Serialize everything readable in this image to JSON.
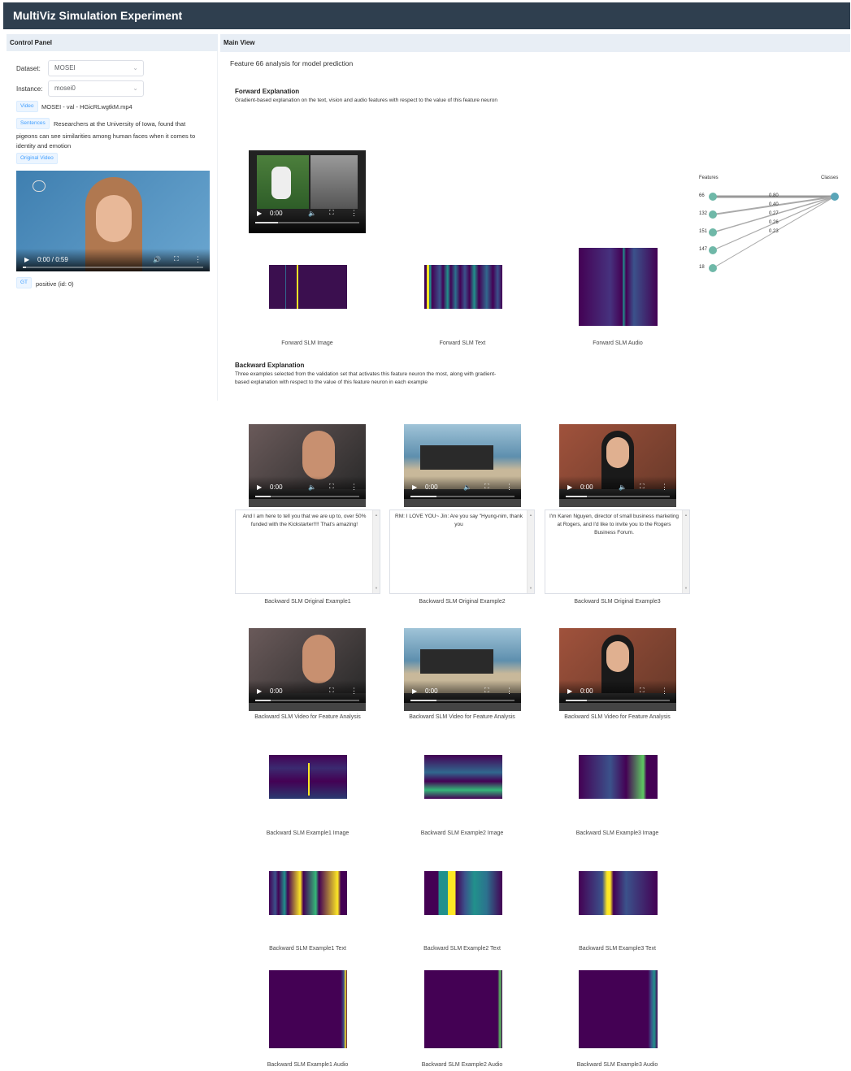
{
  "app": {
    "title": "MultiViz Simulation Experiment"
  },
  "control_panel": {
    "title": "Control Panel",
    "dataset_label": "Dataset:",
    "dataset_value": "MOSEI",
    "instance_label": "Instance:",
    "instance_value": "mosei0",
    "video_tag": "Video",
    "video_text": "MOSEI - val - HGicRLwgtkM.mp4",
    "sentences_tag": "Sentences",
    "sentences_text_line1": "Researchers at the University of Iowa, found that",
    "sentences_text_line2": "pigeons can see similarities among human faces when it comes to",
    "sentences_text_line3": "identity and emotion",
    "original_video_tag": "Original Video",
    "player_time": "0:00 / 0:59",
    "gt_tag": "GT",
    "gt_text": "positive (id: 0)"
  },
  "main_view": {
    "title": "Main View",
    "subtitle": "Feature 66 analysis for model prediction",
    "forward": {
      "title": "Forward Explanation",
      "desc": "Gradient-based explanation on the text, vision and audio features with respect to the value of this feature neuron",
      "player_time": "0:00",
      "captions": [
        "Forward SLM Image",
        "Forward SLM Text",
        "Forward SLM Audio"
      ]
    },
    "graph": {
      "features_label": "Features",
      "classes_label": "Classes",
      "nodes": [
        "66",
        "132",
        "151",
        "147",
        "18"
      ],
      "weights": [
        "0.80",
        "0.40",
        "0.27",
        "0.26",
        "0.23"
      ]
    },
    "backward": {
      "title": "Backward Explanation",
      "desc_line1": "Three examples selected from the validation set that activates this feature neuron the most, along with gradient-",
      "desc_line2": "based explanation with respect to the value of this feature neuron in each example",
      "player_time": "0:00",
      "transcripts": [
        "And I am here to tell you that we are up to, over 50% funded with the Kickstarter!!!! That's amazing!",
        "RM: I LOVE YOU~ Jin: Are you say \"Hyung-nim, thank you",
        "I'm Karen Nguyen, director of small business marketing at Rogers, and I'd like to invite you to the Rogers Business Forum."
      ],
      "original_captions": [
        "Backward SLM Original Example1",
        "Backward SLM Original Example2",
        "Backward SLM Original Example3"
      ],
      "feature_video_caption": "Backward SLM Video for Feature Analysis",
      "image_captions": [
        "Backward SLM Example1 Image",
        "Backward SLM Example2 Image",
        "Backward SLM Example3 Image"
      ],
      "text_captions": [
        "Backward SLM Example1 Text",
        "Backward SLM Example2 Text",
        "Backward SLM Example3 Text"
      ],
      "audio_captions": [
        "Backward SLM Example1 Audio",
        "Backward SLM Example2 Audio",
        "Backward SLM Example3 Audio"
      ]
    }
  },
  "colors": {
    "header": "#2f3f4f",
    "accent": "#409eff",
    "heat_bg": "#3b0f4f",
    "node": "#6fb8a8"
  }
}
